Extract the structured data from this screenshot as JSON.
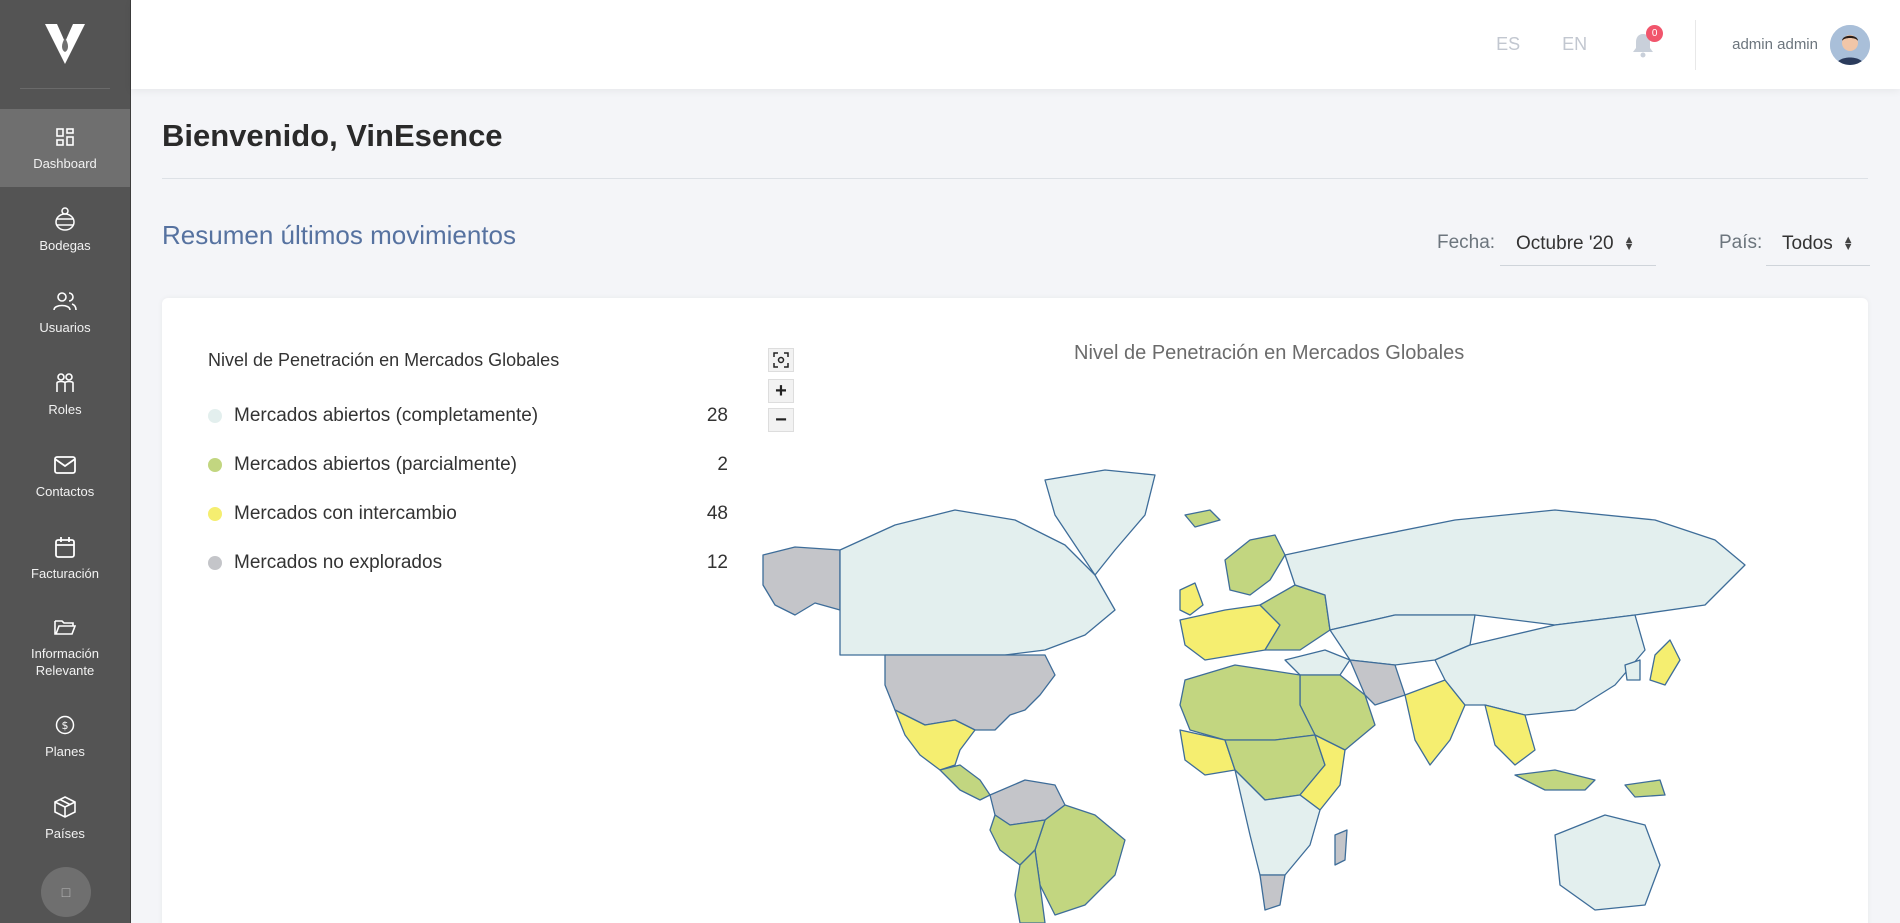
{
  "sidebar": {
    "items": [
      {
        "label": "Dashboard",
        "icon": "dashboard-icon",
        "active": true
      },
      {
        "label": "Bodegas",
        "icon": "winery-icon"
      },
      {
        "label": "Usuarios",
        "icon": "users-icon"
      },
      {
        "label": "Roles",
        "icon": "roles-icon"
      },
      {
        "label": "Contactos",
        "icon": "envelope-icon"
      },
      {
        "label": "Facturación",
        "icon": "calendar-icon"
      },
      {
        "label": "Información\nRelevante",
        "icon": "folder-icon"
      },
      {
        "label": "Planes",
        "icon": "dollar-icon"
      },
      {
        "label": "Países",
        "icon": "box-icon"
      }
    ]
  },
  "header": {
    "lang_es": "ES",
    "lang_en": "EN",
    "notifications": "0",
    "user_name": "admin admin"
  },
  "page": {
    "title": "Bienvenido, VinEsence",
    "section_title": "Resumen últimos movimientos",
    "date_label": "Fecha:",
    "date_value": "Octubre '20",
    "country_label": "País:",
    "country_value": "Todos"
  },
  "legend": {
    "title": "Nivel de Penetración en Mercados Globales",
    "items": [
      {
        "label": "Mercados abiertos (completamente)",
        "count": "28",
        "color": "#e3efee"
      },
      {
        "label": "Mercados abiertos (parcialmente)",
        "count": "2",
        "color": "#c2d680"
      },
      {
        "label": "Mercados con intercambio",
        "count": "48",
        "color": "#f5ee70"
      },
      {
        "label": "Mercados no explorados",
        "count": "12",
        "color": "#c4c5c9"
      }
    ]
  },
  "map": {
    "title": "Nivel de Penetración en Mercados Globales",
    "zoom_in": "+",
    "zoom_out": "−"
  }
}
